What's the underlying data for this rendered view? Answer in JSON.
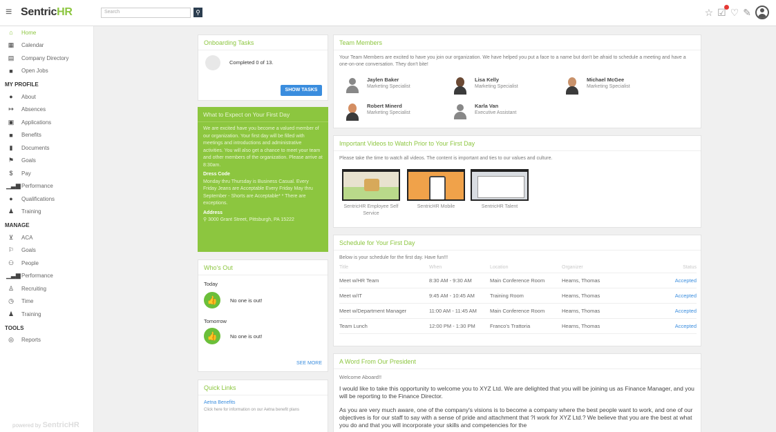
{
  "topbar": {
    "app_name": "Sentric",
    "app_name_accent": "HR",
    "search_placeholder": "Search",
    "icons": [
      "star-icon",
      "tasks-icon",
      "favorites-icon",
      "notes-icon",
      "avatar-icon"
    ]
  },
  "sidebar": {
    "main": [
      {
        "label": "Home",
        "icon": "home-icon",
        "active": true
      },
      {
        "label": "Calendar",
        "icon": "calendar-icon"
      },
      {
        "label": "Company Directory",
        "icon": "directory-icon"
      },
      {
        "label": "Open Jobs",
        "icon": "briefcase-icon"
      }
    ],
    "my_profile_title": "MY PROFILE",
    "my_profile": [
      {
        "label": "About",
        "icon": "person-icon"
      },
      {
        "label": "Absences",
        "icon": "absence-icon"
      },
      {
        "label": "Applications",
        "icon": "applications-icon"
      },
      {
        "label": "Benefits",
        "icon": "benefits-icon"
      },
      {
        "label": "Documents",
        "icon": "document-icon"
      },
      {
        "label": "Goals",
        "icon": "flag-icon"
      },
      {
        "label": "Pay",
        "icon": "dollar-icon"
      },
      {
        "label": "Performance",
        "icon": "chart-icon"
      },
      {
        "label": "Qualifications",
        "icon": "qualification-icon"
      },
      {
        "label": "Training",
        "icon": "training-icon"
      }
    ],
    "manage_title": "MANAGE",
    "manage": [
      {
        "label": "ACA",
        "icon": "cart-icon"
      },
      {
        "label": "Goals",
        "icon": "flag-outline-icon"
      },
      {
        "label": "People",
        "icon": "people-icon"
      },
      {
        "label": "Performance",
        "icon": "chart-icon"
      },
      {
        "label": "Recruiting",
        "icon": "recruit-icon"
      },
      {
        "label": "Time",
        "icon": "clock-icon"
      },
      {
        "label": "Training",
        "icon": "training-icon"
      }
    ],
    "tools_title": "TOOLS",
    "tools": [
      {
        "label": "Reports",
        "icon": "reports-icon"
      }
    ],
    "powered_by": "powered by",
    "powered_brand": "SentricHR"
  },
  "onboarding": {
    "title": "Onboarding Tasks",
    "completed": "Completed 0 of 13.",
    "button": "SHOW TASKS"
  },
  "expect": {
    "title": "What to Expect on Your First Day",
    "intro": "We are excited have you become a valued member of our organization. Your first day will be filled with meetings and introductions and administrative activities. You will also get a chance to meet your team and other members of the organization. Please arrive at 8:30am.",
    "dress_code_title": "Dress Code",
    "dress_code": "Monday thru Thursday is Business Casual. Every Friday Jeans are Acceptable Every Friday May thru September - Shorts are Acceptable* * There are exceptions.",
    "address_title": "Address",
    "address": "3000 Grant Street, Pittsburgh, PA 15222"
  },
  "whos_out": {
    "title": "Who's Out",
    "today_label": "Today",
    "today_value": "No one is out!",
    "tomorrow_label": "Tomorrow",
    "tomorrow_value": "No one is out!",
    "see_more": "SEE MORE"
  },
  "quick_links": {
    "title": "Quick Links",
    "link": "Aetna Benefits",
    "desc": "Click here for information on our Aetna benefit plans"
  },
  "team": {
    "title": "Team Members",
    "intro": "Your Team Members are excited to have you join our organization. We have helped you put a face to a name but don't be afraid to schedule a meeting and have a one-on-one conversation. They don't bite!",
    "members": [
      {
        "name": "Jaylen Baker",
        "role": "Marketing Specialist"
      },
      {
        "name": "Lisa Kelly",
        "role": "Marketing Specialist"
      },
      {
        "name": "Michael McGee",
        "role": "Marketing Specialist"
      },
      {
        "name": "Robert Minerd",
        "role": "Marketing Specialist"
      },
      {
        "name": "Karla Van",
        "role": "Executive Assistant"
      }
    ]
  },
  "videos": {
    "title": "Important Videos to Watch Prior to Your First Day",
    "intro": "Please take the time to watch all videos. The content is important and ties to our values and culture.",
    "items": [
      {
        "caption": "SentricHR Employee Self Service"
      },
      {
        "caption": "SentricHR Mobile"
      },
      {
        "caption": "SentricHR Talent"
      }
    ]
  },
  "schedule": {
    "title": "Schedule for Your First Day",
    "intro": "Below is your schedule for the first day. Have fun!!!",
    "columns": [
      "Title",
      "When",
      "Location",
      "Organizer",
      "Status"
    ],
    "rows": [
      [
        "Meet w/HR Team",
        "8:30 AM - 9:30 AM",
        "Main Conference Room",
        "Hearns, Thomas",
        "Accepted"
      ],
      [
        "Meet w/IT",
        "9:45 AM - 10:45 AM",
        "Training Room",
        "Hearns, Thomas",
        "Accepted"
      ],
      [
        "Meet w/Department Manager",
        "11:00 AM - 11:45 AM",
        "Main Conference Room",
        "Hearns, Thomas",
        "Accepted"
      ],
      [
        "Team Lunch",
        "12:00 PM - 1:30 PM",
        "Franco's Trattoria",
        "Hearns, Thomas",
        "Accepted"
      ]
    ]
  },
  "president": {
    "title": "A Word From Our President",
    "welcome": "Welcome Aboard!!",
    "p1": "I would like to take this opportunity to welcome you to XYZ Ltd. We are delighted that you will be joining us as Finance Manager, and you will be reporting to the Finance Director.",
    "p2": "As you are very much aware, one of the company's visions is to become a company where the best people want to work, and one of our objectives is for our staff to say with a sense of pride and attachment that ?I work for XYZ Ltd.? We believe that you are the best at what you do and that you will incorporate your skills and competencies for the"
  },
  "colors": {
    "accent_green": "#8cc63f",
    "link_blue": "#3a8dde",
    "button_blue": "#3a8dde"
  }
}
